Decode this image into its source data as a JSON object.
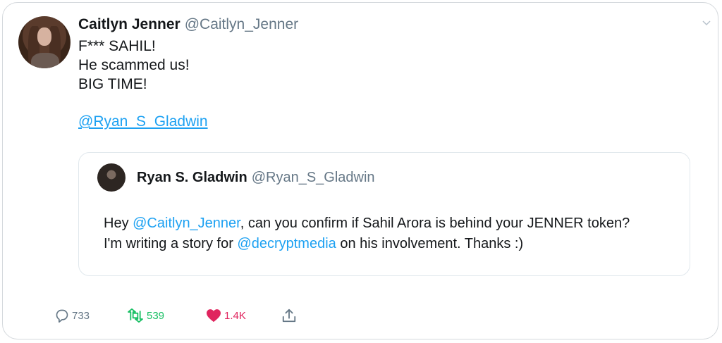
{
  "author": {
    "name": "Caitlyn Jenner",
    "handle": "@Caitlyn_Jenner"
  },
  "tweet": {
    "lines": [
      "F*** SAHIL!",
      "He scammed us!",
      "BIG TIME!"
    ],
    "mention": "@Ryan_S_Gladwin"
  },
  "quoted": {
    "name": "Ryan S. Gladwin",
    "handle": "@Ryan_S_Gladwin",
    "line1": {
      "pre": "Hey ",
      "mention": "@Caitlyn_Jenner",
      "post": ", can you confirm if Sahil Arora is behind your JENNER token?"
    },
    "line2": {
      "pre": "I'm writing a story for ",
      "mention": "@decryptmedia",
      "post": " on his involvement. Thanks :)"
    }
  },
  "actions": {
    "replies": "733",
    "retweets": "539",
    "likes": "1.4K"
  },
  "colors": {
    "accent": "#1da1f2",
    "retweet": "#17bf63",
    "like": "#e0245e",
    "secondary": "#657786"
  },
  "icons": [
    "chevron-down-icon",
    "reply-icon",
    "retweet-icon",
    "heart-icon",
    "share-icon"
  ]
}
